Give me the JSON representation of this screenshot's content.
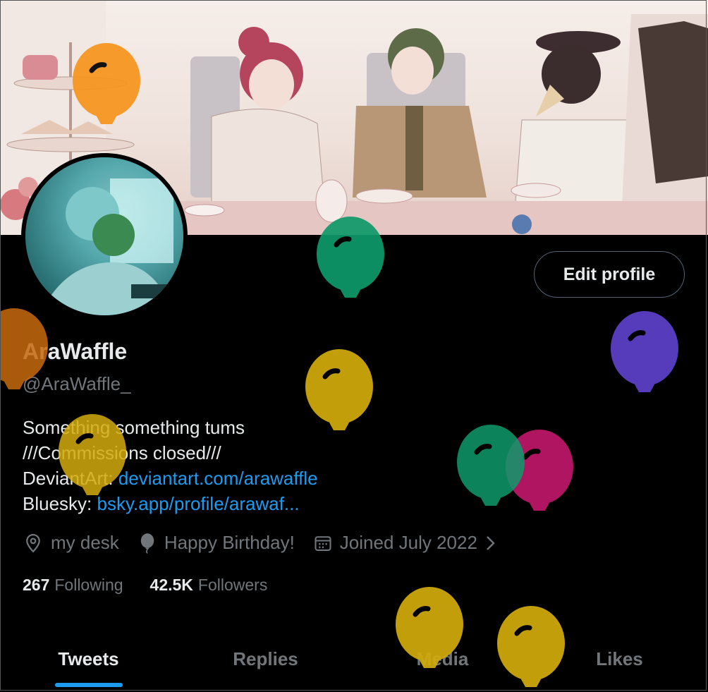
{
  "profile": {
    "display_name": "AraWaffle",
    "handle": "@AraWaffle_",
    "edit_button_label": "Edit profile"
  },
  "bio": {
    "line1": "Something something tums",
    "line2": "///Commissions closed///",
    "deviantart_label": "DeviantArt: ",
    "deviantart_link": "deviantart.com/arawaffle",
    "bluesky_label": "Bluesky: ",
    "bluesky_link": "bsky.app/profile/arawaf..."
  },
  "meta": {
    "location": "my desk",
    "birthday": "Happy Birthday!",
    "joined": "Joined July 2022"
  },
  "stats": {
    "following_count": "267",
    "following_label": "Following",
    "followers_count": "42.5K",
    "followers_label": "Followers"
  },
  "tabs": [
    {
      "label": "Tweets",
      "active": true
    },
    {
      "label": "Replies",
      "active": false
    },
    {
      "label": "Media",
      "active": false
    },
    {
      "label": "Likes",
      "active": false
    }
  ],
  "colors": {
    "accent": "#1d9bf0",
    "text": "#e7e9ea",
    "muted": "#71767b",
    "background": "#000000"
  },
  "icons": [
    "location-pin-icon",
    "balloon-icon",
    "calendar-icon",
    "chevron-right-icon"
  ],
  "decorations": {
    "birthday_balloon_colors": [
      "#f7941d",
      "#c76a0e",
      "#0f9a6b",
      "#d4ac0d",
      "#d4ac0d",
      "#5b3fc4",
      "#0f9a6b",
      "#c2186b",
      "#d4ac0d",
      "#d4ac0d"
    ]
  }
}
